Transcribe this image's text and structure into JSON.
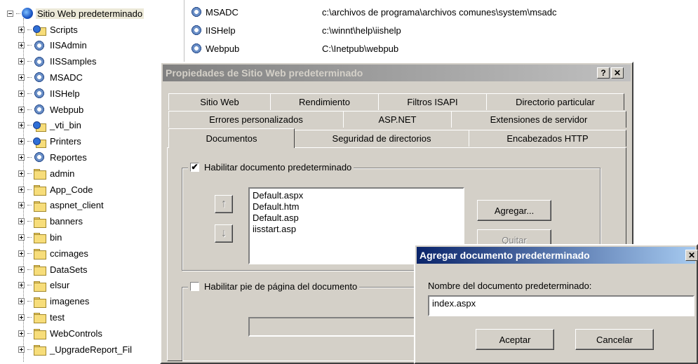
{
  "tree": {
    "root_label": "Sitio Web predeterminado",
    "items": [
      {
        "label": "Scripts",
        "icon": "web-folder-icon"
      },
      {
        "label": "IISAdmin",
        "icon": "gear-icon"
      },
      {
        "label": "IISSamples",
        "icon": "gear-icon"
      },
      {
        "label": "MSADC",
        "icon": "gear-icon"
      },
      {
        "label": "IISHelp",
        "icon": "gear-icon"
      },
      {
        "label": "Webpub",
        "icon": "gear-icon"
      },
      {
        "label": "_vti_bin",
        "icon": "web-folder-icon"
      },
      {
        "label": "Printers",
        "icon": "web-folder-icon"
      },
      {
        "label": "Reportes",
        "icon": "gear-icon"
      },
      {
        "label": "admin",
        "icon": "folder-icon"
      },
      {
        "label": "App_Code",
        "icon": "folder-icon"
      },
      {
        "label": "aspnet_client",
        "icon": "folder-icon"
      },
      {
        "label": "banners",
        "icon": "folder-icon"
      },
      {
        "label": "bin",
        "icon": "folder-icon"
      },
      {
        "label": "ccimages",
        "icon": "folder-icon"
      },
      {
        "label": "DataSets",
        "icon": "folder-icon"
      },
      {
        "label": "elsur",
        "icon": "folder-icon"
      },
      {
        "label": "imagenes",
        "icon": "folder-icon"
      },
      {
        "label": "test",
        "icon": "folder-icon"
      },
      {
        "label": "WebControls",
        "icon": "folder-icon"
      },
      {
        "label": "_UpgradeReport_Fil",
        "icon": "folder-icon"
      }
    ]
  },
  "list": {
    "rows": [
      {
        "name": "MSADC",
        "path": "c:\\archivos de programa\\archivos comunes\\system\\msadc"
      },
      {
        "name": "IISHelp",
        "path": "c:\\winnt\\help\\iishelp"
      },
      {
        "name": "Webpub",
        "path": "C:\\Inetpub\\webpub"
      }
    ]
  },
  "props_dialog": {
    "title": "Propiedades de Sitio Web predeterminado",
    "help_label": "?",
    "close_label": "✕",
    "tabs_row1": [
      "Sitio Web",
      "Rendimiento",
      "Filtros ISAPI",
      "Directorio particular"
    ],
    "tabs_row2": [
      "Errores personalizados",
      "ASP.NET",
      "Extensiones de servidor"
    ],
    "tabs_row3": [
      "Documentos",
      "Seguridad de directorios",
      "Encabezados HTTP"
    ],
    "enable_default_doc": "Habilitar documento predeterminado",
    "enable_default_doc_checked": "✔",
    "documents": [
      "Default.aspx",
      "Default.htm",
      "Default.asp",
      "iisstart.asp"
    ],
    "up_arrow": "↑",
    "down_arrow": "↓",
    "add_button": "Agregar...",
    "remove_button": "Quitar",
    "enable_footer": "Habilitar pie de página del documento"
  },
  "add_dialog": {
    "title": "Agregar documento predeterminado",
    "close_label": "✕",
    "field_label": "Nombre del documento predeterminado:",
    "field_value": "index.aspx",
    "ok_button": "Aceptar",
    "cancel_button": "Cancelar"
  }
}
